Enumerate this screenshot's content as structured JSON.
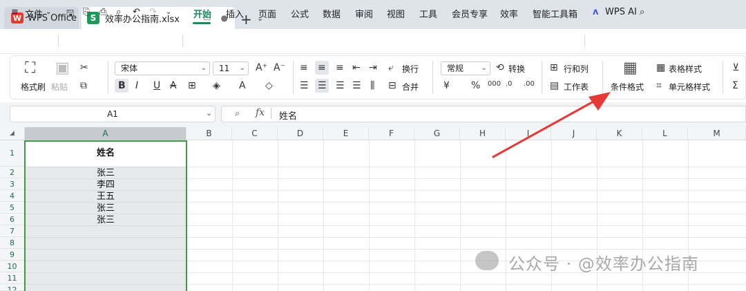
{
  "tabs": {
    "app_label": "WPS Office",
    "file_label": "效率办公指南.xlsx",
    "new_tab": "+"
  },
  "menu": {
    "file": "文件",
    "items": [
      "开始",
      "插入",
      "页面",
      "公式",
      "数据",
      "审阅",
      "视图",
      "工具",
      "会员专享",
      "效率",
      "智能工具箱"
    ],
    "active": "开始",
    "ai": "WPS AI"
  },
  "ribbon": {
    "format_painter": "格式刷",
    "paste": "粘贴",
    "font_name": "宋体",
    "font_size": "11",
    "wrap": "换行",
    "merge": "合并",
    "number_format": "常规",
    "convert": "转换",
    "row_col": "行和列",
    "worksheet": "工作表",
    "conditional_format": "条件格式",
    "table_style": "表格样式",
    "cell_style": "单元格样式"
  },
  "formula_bar": {
    "name_box": "A1",
    "fx": "fx",
    "content": "姓名"
  },
  "grid": {
    "columns": [
      "A",
      "B",
      "C",
      "D",
      "E",
      "F",
      "G",
      "H",
      "I",
      "J",
      "K",
      "L",
      "M"
    ],
    "rows": [
      "1",
      "2",
      "3",
      "4",
      "5",
      "6",
      "7",
      "8",
      "9",
      "10",
      "11",
      "12"
    ],
    "colA": [
      "姓名",
      "张三",
      "李四",
      "王五",
      "张三",
      "张三",
      "",
      "",
      "",
      "",
      "",
      ""
    ]
  },
  "watermark": "公众号 · @效率办公指南",
  "colors": {
    "accent": "#1c8a5b",
    "selection": "#3c9a46",
    "arrow": "#e53935"
  }
}
